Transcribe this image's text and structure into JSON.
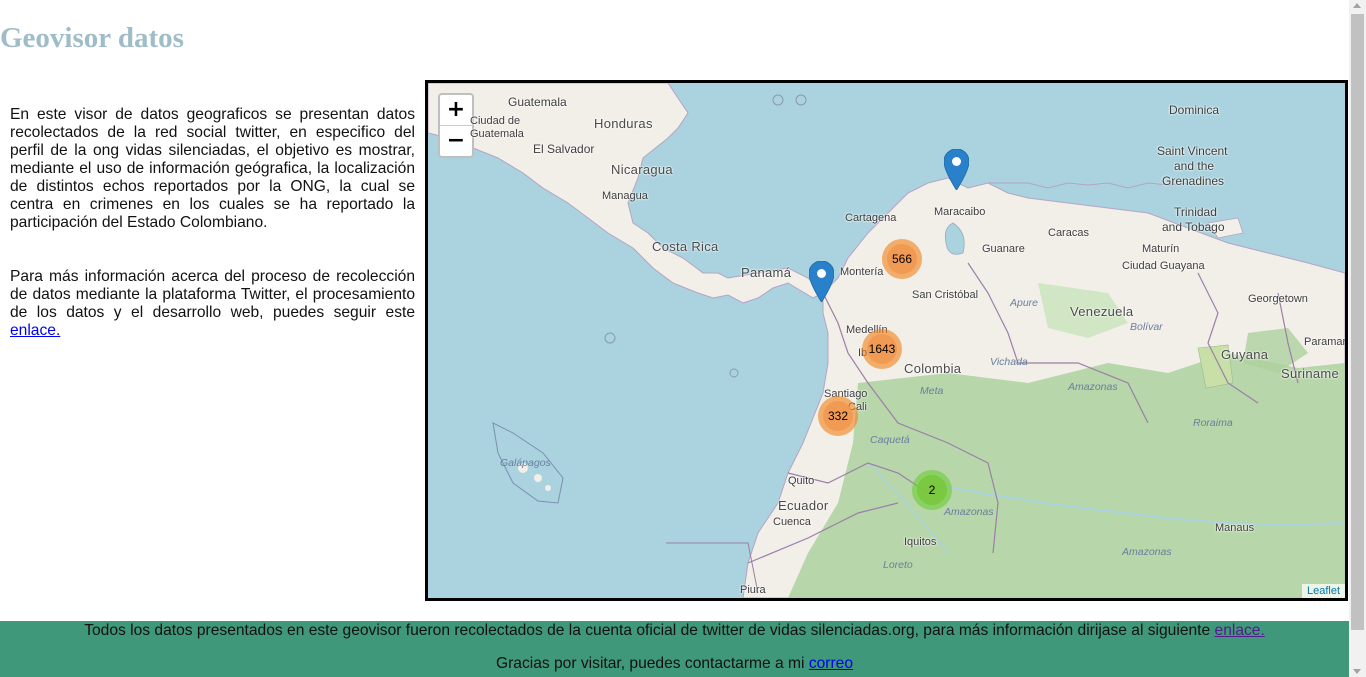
{
  "title": "Geovisor datos",
  "intro": {
    "p1": "En este visor de datos geograficos se presentan datos recolectados de la red social twitter, en especifico del perfil de la ong vidas silenciadas, el objetivo es mostrar, mediante el uso de información geógrafica, la localización de distintos echos reportados por la ONG, la cual se centra en crimenes en los cuales se ha reportado la participación del Estado Colombiano.",
    "p2_text": "Para más información acerca del proceso de recolección de datos mediante la plataforma Twitter, el procesamiento de los datos y el desarrollo web, puedes seguir este ",
    "p2_link": "enlace."
  },
  "map": {
    "zoom_in": "+",
    "zoom_out": "−",
    "attribution": "Leaflet",
    "labels": {
      "guatemala": "Guatemala",
      "ciudad_guatemala_1": "Ciudad de",
      "ciudad_guatemala_2": "Guatemala",
      "honduras": "Honduras",
      "el_salvador": "El Salvador",
      "nicaragua": "Nicaragua",
      "managua": "Managua",
      "costa_rica": "Costa Rica",
      "panama": "Panamá",
      "cartagena": "Cartagena",
      "maracaibo": "Maracaibo",
      "monteria": "Montería",
      "guanare": "Guanare",
      "caracas": "Caracas",
      "maturin": "Maturín",
      "ciudad_guayana": "Ciudad Guayana",
      "dominica": "Dominica",
      "saint_vincent": "Saint Vincent",
      "and_the": "and the",
      "grenadines": "Grenadines",
      "trinidad": "Trinidad",
      "and_tobago": "and Tobago",
      "san_cristobal": "San Cristóbal",
      "apure": "Apure",
      "venezuela": "Venezuela",
      "bolivar": "Bolívar",
      "georgetown": "Georgetown",
      "paramaribo": "Paramar",
      "medellin": "Medellín",
      "ibague": "Ib",
      "colombia": "Colombia",
      "vichada": "Vichada",
      "guyana": "Guyana",
      "suriname": "Suriname",
      "meta": "Meta",
      "amazonas_ve": "Amazonas",
      "roraima": "Roraima",
      "santiago": "Santiago",
      "cali": "Cali",
      "caqueta": "Caquetá",
      "galapagos": "Galápagos",
      "quito": "Quito",
      "ecuador": "Ecuador",
      "cuenca": "Cuenca",
      "amazonas_co": "Amazonas",
      "iquitos": "Iquitos",
      "manaus": "Manaus",
      "amazonas_br": "Amazonas",
      "loreto": "Loreto",
      "piura": "Piura"
    },
    "clusters": [
      {
        "id": "cluster-566",
        "count": "566",
        "color": "orange"
      },
      {
        "id": "cluster-1643",
        "count": "1643",
        "color": "orange"
      },
      {
        "id": "cluster-332",
        "count": "332",
        "color": "orange"
      },
      {
        "id": "cluster-2",
        "count": "2",
        "color": "green"
      }
    ]
  },
  "footer": {
    "line1_text": "Todos los datos presentados en este geovisor fueron recolectados de la cuenta oficial de twitter de vidas silenciadas.org, para más información dirijase al siguiente ",
    "line1_link": "enlace.",
    "line2_text": "Gracias por visitar, puedes contactarme a mi ",
    "line2_link": "correo"
  },
  "colors": {
    "title": "#9fbdc8",
    "footer_bg": "#40987a",
    "water": "#aad3df",
    "land": "#f2efe9",
    "forest": "#add19e"
  }
}
